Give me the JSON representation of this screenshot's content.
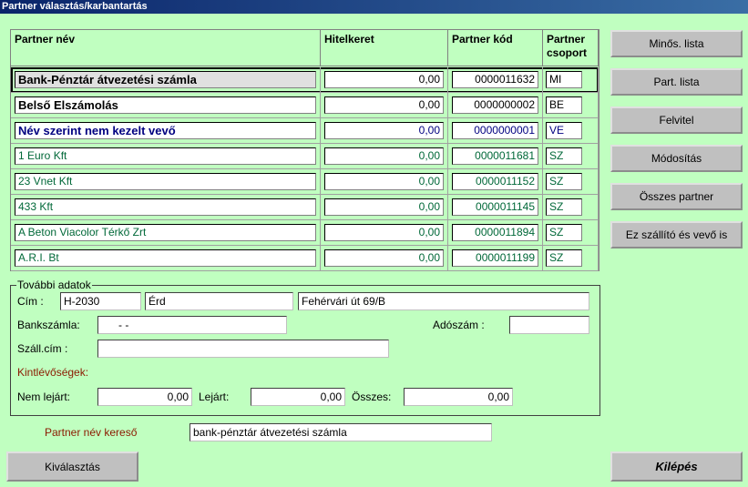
{
  "window": {
    "title": "Partner választás/karbantartás"
  },
  "grid": {
    "headers": {
      "name": "Partner név",
      "credit": "Hitelkeret",
      "code": "Partner kód",
      "group": "Partner csoport"
    },
    "rows": [
      {
        "name": "Bank-Pénztár átvezetési számla",
        "credit": "0,00",
        "code": "0000011632",
        "group": "MI"
      },
      {
        "name": "Belső Elszámolás",
        "credit": "0,00",
        "code": "0000000002",
        "group": "BE"
      },
      {
        "name": "Név szerint nem kezelt vevő",
        "credit": "0,00",
        "code": "0000000001",
        "group": "VE"
      },
      {
        "name": "1 Euro Kft",
        "credit": "0,00",
        "code": "0000011681",
        "group": "SZ"
      },
      {
        "name": "23 Vnet Kft",
        "credit": "0,00",
        "code": "0000011152",
        "group": "SZ"
      },
      {
        "name": "433 Kft",
        "credit": "0,00",
        "code": "0000011145",
        "group": "SZ"
      },
      {
        "name": "A Beton Viacolor Térkő Zrt",
        "credit": "0,00",
        "code": "0000011894",
        "group": "SZ"
      },
      {
        "name": "A.R.I. Bt",
        "credit": "0,00",
        "code": "0000011199",
        "group": "SZ"
      }
    ]
  },
  "side_buttons": {
    "minos": "Minős. lista",
    "part_lista": "Part. lista",
    "felvitel": "Felvitel",
    "modositas": "Módosítás",
    "osszes": "Összes partner",
    "szallito": "Ez szállító és vevő is"
  },
  "details": {
    "title": "További adatok",
    "cim_label": "Cím :",
    "zip": "H-2030",
    "city": "Érd",
    "street": "Fehérvári út 69/B",
    "bank_label": "Bankszámla:",
    "bank_value": "-       -",
    "adoszam_label": "Adószám :",
    "adoszam_value": "",
    "szall_label": "Száll.cím :",
    "szall_value": "",
    "kintl_label": "Kintlévőségek:",
    "nem_lejart_label": "Nem lejárt:",
    "nem_lejart_value": "0,00",
    "lejart_label": "Lejárt:",
    "lejart_value": "0,00",
    "osszes_label": "Összes:",
    "osszes_value": "0,00"
  },
  "search": {
    "label": "Partner név kereső",
    "value": "bank-pénztár átvezetési számla"
  },
  "bottom": {
    "select": "Kiválasztás",
    "exit": "Kilépés"
  }
}
